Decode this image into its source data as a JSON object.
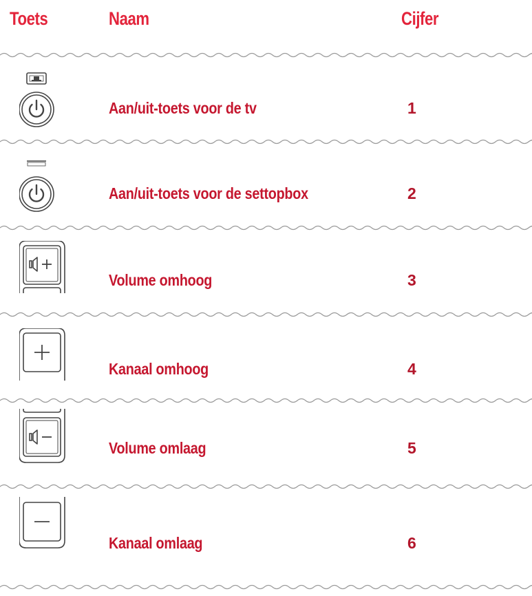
{
  "header": {
    "col_key": "Toets",
    "col_name": "Naam",
    "col_number": "Cijfer"
  },
  "rows": [
    {
      "icon": "tv-power-icon",
      "name": "Aan/uit-toets voor de tv",
      "number": "1"
    },
    {
      "icon": "settopbox-power-icon",
      "name": "Aan/uit-toets voor de settopbox",
      "number": "2"
    },
    {
      "icon": "volume-up-icon",
      "name": "Volume omhoog",
      "number": "3"
    },
    {
      "icon": "channel-up-icon",
      "name": "Kanaal omhoog",
      "number": "4"
    },
    {
      "icon": "volume-down-icon",
      "name": "Volume omlaag",
      "number": "5"
    },
    {
      "icon": "channel-down-icon",
      "name": "Kanaal omlaag",
      "number": "6"
    }
  ],
  "colors": {
    "header": "#e3243b",
    "text": "#c5172f",
    "line": "#9a9a9a"
  }
}
